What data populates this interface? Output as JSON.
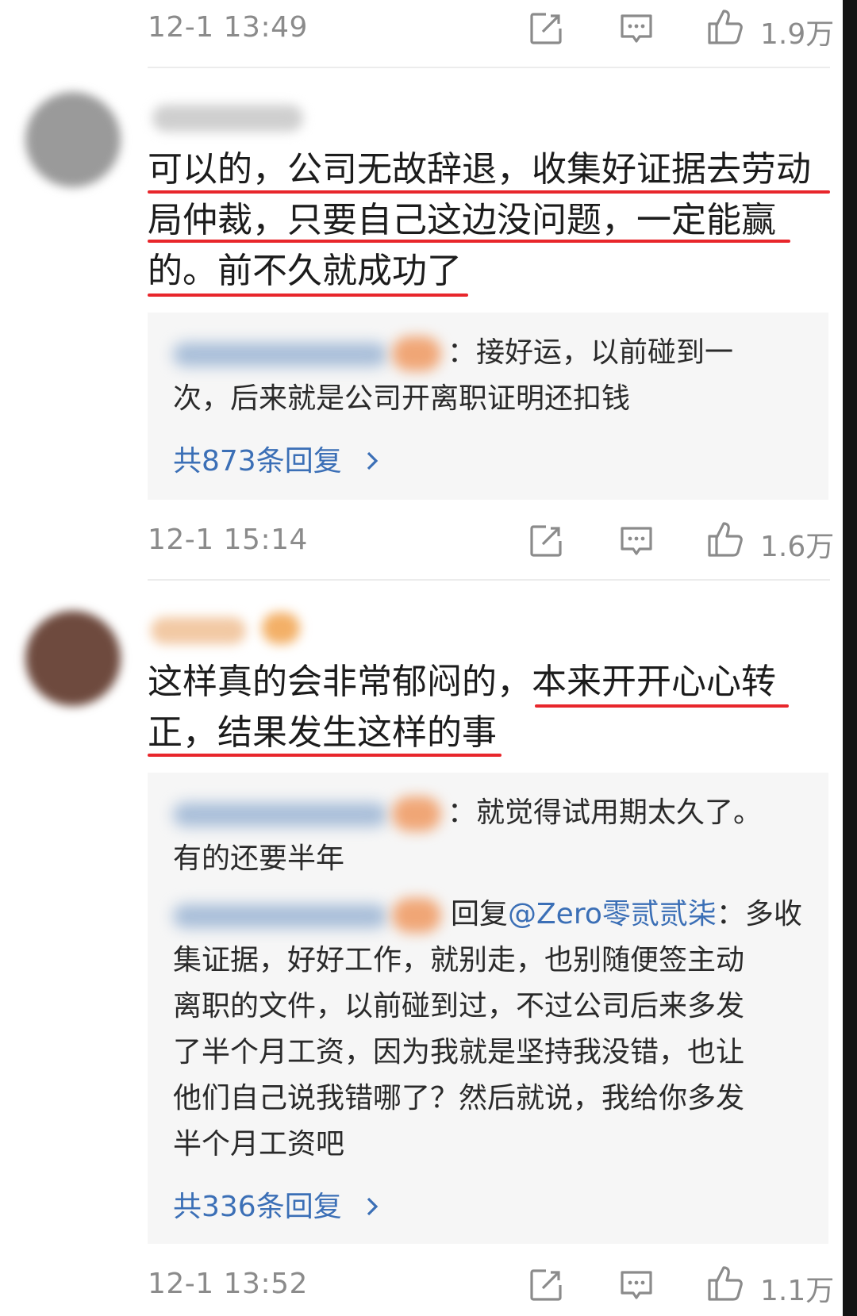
{
  "post1": {
    "time": "12-1 13:49",
    "like_count": "1.9万"
  },
  "comment1": {
    "lines": [
      "可以的，公司无故辞退，收集好证据去劳动",
      "局仲裁，只要自己这边没问题，一定能赢",
      "的。前不久就成功了"
    ],
    "reply_text_line1": "：接好运，以前碰到一",
    "reply_text_line2": "次，后来就是公司开离职证明还扣钱",
    "more_replies": "共873条回复",
    "time": "12-1 15:14",
    "like_count": "1.6万"
  },
  "comment2": {
    "line1_plain": "这样真的会非常郁闷的，",
    "line1_underlined": "本来开开心心转",
    "line2": "正，结果发生这样的事",
    "reply1_line1": "：就觉得试用期太久了。",
    "reply1_line2": "有的还要半年",
    "reply2_prefix": "回复",
    "reply2_mention": "@Zero零贰贰柒",
    "reply2_lines": [
      "：多收",
      "集证据，好好工作，就别走，也别随便签主动",
      "离职的文件，以前碰到过，不过公司后来多发",
      "了半个月工资，因为我就是坚持我没错，也让",
      "他们自己说我错哪了？然后就说，我给你多发",
      "半个月工资吧"
    ],
    "more_replies": "共336条回复",
    "time": "12-1 13:52",
    "like_count": "1.1万"
  },
  "icons": {
    "share": "share-icon",
    "comment": "comment-icon",
    "like": "thumbs-up-icon",
    "chevron": "chevron-right-icon"
  },
  "colors": {
    "underline": "#e8262b",
    "link": "#3b6fb6",
    "meta": "#8b8b8b",
    "reply_bg": "#f6f6f6"
  }
}
